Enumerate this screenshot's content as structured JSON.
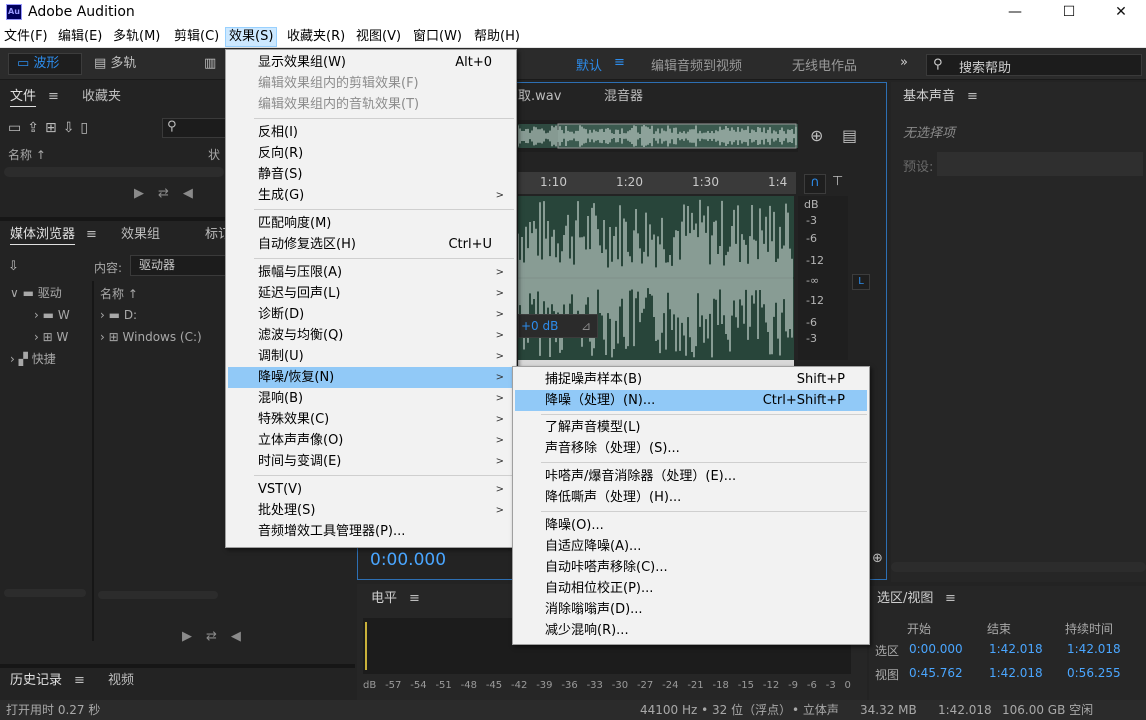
{
  "window": {
    "title": "Adobe Audition",
    "icon_label": "Au",
    "controls": [
      "minimize-icon",
      "maximize-icon",
      "close-icon"
    ]
  },
  "menubar": {
    "items": [
      "文件(F)",
      "编辑(E)",
      "多轨(M)",
      "剪辑(C)",
      "效果(S)",
      "收藏夹(R)",
      "视图(V)",
      "窗口(W)",
      "帮助(H)"
    ],
    "active": "效果(S)"
  },
  "toolbar": {
    "waveform": "波形",
    "multitrack": "多轨",
    "workspace_default": "默认",
    "workspace_edit_video": "编辑音频到视频",
    "workspace_radio": "无线电作品",
    "more": "»",
    "search_placeholder": "搜索帮助"
  },
  "files_panel": {
    "tab_files": "文件",
    "tab_favorites": "收藏夹",
    "col_name": "名称",
    "col_status": "状"
  },
  "media_browser": {
    "tab_media": "媒体浏览器",
    "tab_effects": "效果组",
    "tab_markers": "标订",
    "content_label": "内容:",
    "content_value": "驱动器",
    "col_name": "名称",
    "tree": [
      "驱动",
      "W",
      "W",
      "快捷"
    ],
    "drives": [
      "D:",
      "Windows (C:)"
    ]
  },
  "history": {
    "tab_history": "历史记录",
    "tab_video": "视频"
  },
  "editor": {
    "file_tab": "取.wav",
    "mixer_tab": "混音器",
    "ruler_labels": [
      "1:10",
      "1:20",
      "1:30",
      "1:4"
    ],
    "db_labels": [
      "dB",
      "-3",
      "-6",
      "-12",
      "-∞",
      "-12",
      "-6",
      "-3"
    ],
    "channel": "L",
    "hud_gain": "+0 dB",
    "time": "0:00.000"
  },
  "essential_sound": {
    "title": "基本声音",
    "no_selection": "无选择项",
    "preset_label": "预设:"
  },
  "levels": {
    "title": "电平",
    "ticks": [
      "dB",
      "-57",
      "-54",
      "-51",
      "-48",
      "-45",
      "-42",
      "-39",
      "-36",
      "-33",
      "-30",
      "-27",
      "-24",
      "-21",
      "-18",
      "-15",
      "-12",
      "-9",
      "-6",
      "-3",
      "0"
    ]
  },
  "selection_view": {
    "title": "选区/视图",
    "col_start": "开始",
    "col_end": "结束",
    "col_duration": "持续时间",
    "rows": [
      {
        "label": "选区",
        "start": "0:00.000",
        "end": "1:42.018",
        "duration": "1:42.018"
      },
      {
        "label": "视图",
        "start": "0:45.762",
        "end": "1:42.018",
        "duration": "0:56.255"
      }
    ]
  },
  "status": {
    "left": "打开用时 0.27 秒",
    "sample_rate": "44100 Hz • 32 位（浮点）",
    "channels": "• 立体声",
    "size": "34.32 MB",
    "duration": "1:42.018",
    "free": "106.00 GB 空闲"
  },
  "effects_menu": {
    "items": [
      {
        "label": "显示效果组(W)",
        "shortcut": "Alt+0"
      },
      {
        "label": "编辑效果组内的剪辑效果(F)",
        "disabled": true
      },
      {
        "label": "编辑效果组内的音轨效果(T)",
        "disabled": true
      },
      {
        "label": "反相(I)"
      },
      {
        "label": "反向(R)"
      },
      {
        "label": "静音(S)"
      },
      {
        "label": "生成(G)",
        "submenu": true
      },
      {
        "label": "匹配响度(M)"
      },
      {
        "label": "自动修复选区(H)",
        "shortcut": "Ctrl+U"
      },
      {
        "label": "振幅与压限(A)",
        "submenu": true
      },
      {
        "label": "延迟与回声(L)",
        "submenu": true
      },
      {
        "label": "诊断(D)",
        "submenu": true
      },
      {
        "label": "滤波与均衡(Q)",
        "submenu": true
      },
      {
        "label": "调制(U)",
        "submenu": true
      },
      {
        "label": "降噪/恢复(N)",
        "submenu": true,
        "highlighted": true
      },
      {
        "label": "混响(B)",
        "submenu": true
      },
      {
        "label": "特殊效果(C)",
        "submenu": true
      },
      {
        "label": "立体声声像(O)",
        "submenu": true
      },
      {
        "label": "时间与变调(E)",
        "submenu": true
      },
      {
        "label": "VST(V)",
        "submenu": true
      },
      {
        "label": "批处理(S)",
        "submenu": true
      },
      {
        "label": "音频增效工具管理器(P)..."
      }
    ]
  },
  "noise_submenu": {
    "items": [
      {
        "label": "捕捉噪声样本(B)",
        "shortcut": "Shift+P"
      },
      {
        "label": "降噪（处理）(N)...",
        "shortcut": "Ctrl+Shift+P",
        "highlighted": true
      },
      {
        "label": "了解声音模型(L)"
      },
      {
        "label": "声音移除（处理）(S)..."
      },
      {
        "label": "咔嗒声/爆音消除器（处理）(E)..."
      },
      {
        "label": "降低嘶声（处理）(H)..."
      },
      {
        "label": "降噪(O)..."
      },
      {
        "label": "自适应降噪(A)..."
      },
      {
        "label": "自动咔嗒声移除(C)..."
      },
      {
        "label": "自动相位校正(P)..."
      },
      {
        "label": "消除嗡嗡声(D)..."
      },
      {
        "label": "减少混响(R)..."
      }
    ]
  },
  "colors": {
    "accent": "#2d8ceb",
    "waveform_bg": "#28453a",
    "waveform": "#e8f2ee",
    "menu_highlight": "#91c9f7"
  }
}
